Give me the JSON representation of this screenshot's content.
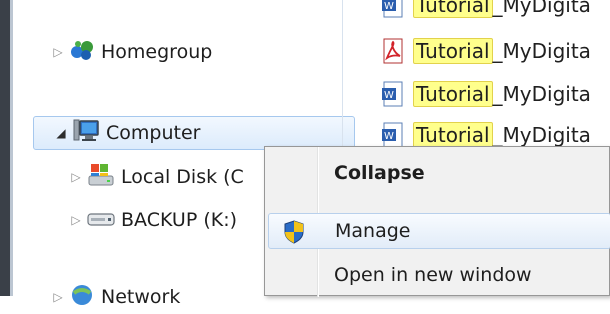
{
  "nav_tree": {
    "homegroup": {
      "label": "Homegroup",
      "icon": "homegroup-icon"
    },
    "computer": {
      "label": "Computer",
      "icon": "computer-icon"
    },
    "local_disk": {
      "label": "Local Disk (C",
      "icon": "local-disk-icon"
    },
    "backup": {
      "label": "BACKUP (K:)",
      "icon": "drive-icon"
    },
    "network": {
      "label": "Network",
      "icon": "network-icon"
    }
  },
  "files": [
    {
      "highlight": "Tutorial",
      "rest": "_MyDigita",
      "icon": "word-doc-icon"
    },
    {
      "highlight": "Tutorial",
      "rest": "_MyDigita",
      "icon": "pdf-icon"
    },
    {
      "highlight": "Tutorial",
      "rest": "_MyDigita",
      "icon": "word-doc-icon"
    },
    {
      "highlight": "Tutorial",
      "rest": "_MyDigita",
      "icon": "word-doc-icon"
    }
  ],
  "context_menu": {
    "collapse": "Collapse",
    "manage": "Manage",
    "open_new_window": "Open in new window"
  },
  "colors": {
    "search_highlight": "#ffff8c",
    "selection": "#dcebfc"
  }
}
